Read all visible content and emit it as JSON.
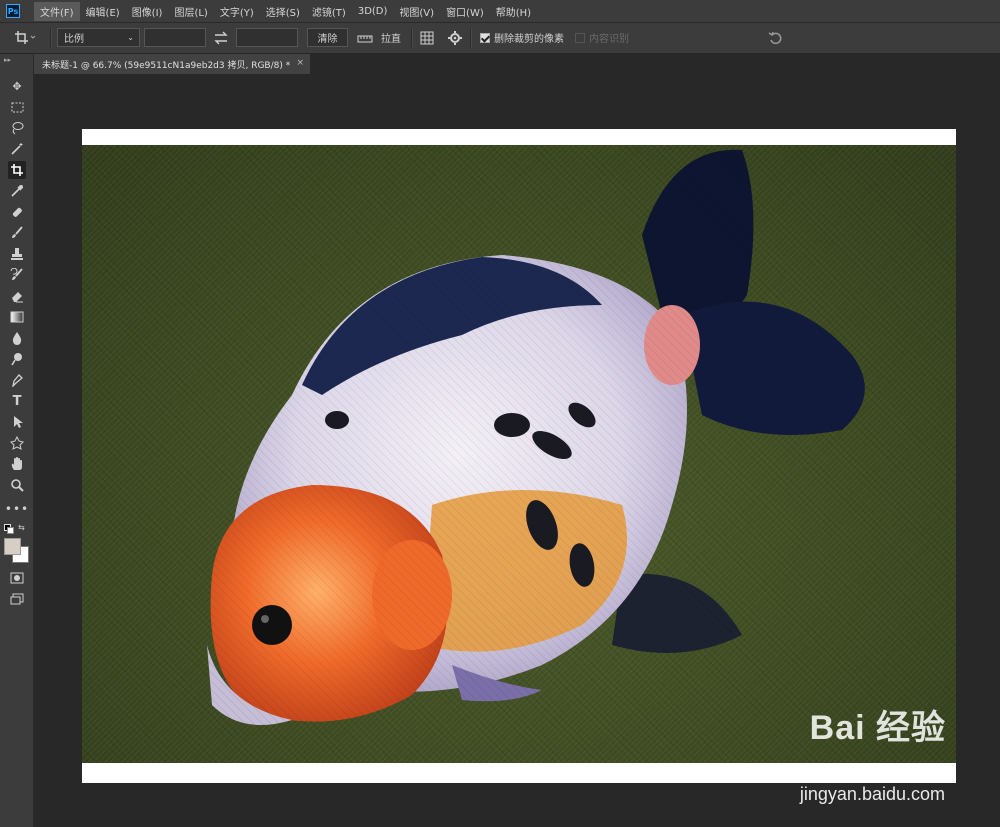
{
  "app": {
    "logo": "Ps"
  },
  "menu": [
    "文件(F)",
    "编辑(E)",
    "图像(I)",
    "图层(L)",
    "文字(Y)",
    "选择(S)",
    "滤镜(T)",
    "3D(D)",
    "视图(V)",
    "窗口(W)",
    "帮助(H)"
  ],
  "options": {
    "ratio_select": "比例",
    "width_value": "",
    "height_value": "",
    "clear_button": "清除",
    "straighten_label": "拉直",
    "delete_cropped_label": "删除裁剪的像素",
    "delete_cropped_checked": true,
    "content_aware_label": "内容识别",
    "content_aware_checked": false
  },
  "document_tab": {
    "title": "未标题-1 @ 66.7% (59e9511cN1a9eb2d3 拷贝, RGB/8) *",
    "close": "×"
  },
  "watermark": {
    "brand": "Bai 经验",
    "url": "jingyan.baidu.com"
  },
  "tools": [
    "move-icon",
    "marquee-icon",
    "lasso-icon",
    "magic-wand-icon",
    "crop-icon",
    "eyedropper-icon",
    "healing-brush-icon",
    "brush-icon",
    "clone-stamp-icon",
    "history-brush-icon",
    "eraser-icon",
    "gradient-icon",
    "blur-icon",
    "dodge-icon",
    "pen-icon",
    "type-icon",
    "path-selection-icon",
    "shape-icon",
    "hand-icon",
    "zoom-icon",
    "more-tools-icon"
  ],
  "colors": {
    "foreground": "#d8cfc4",
    "background": "#ffffff"
  }
}
